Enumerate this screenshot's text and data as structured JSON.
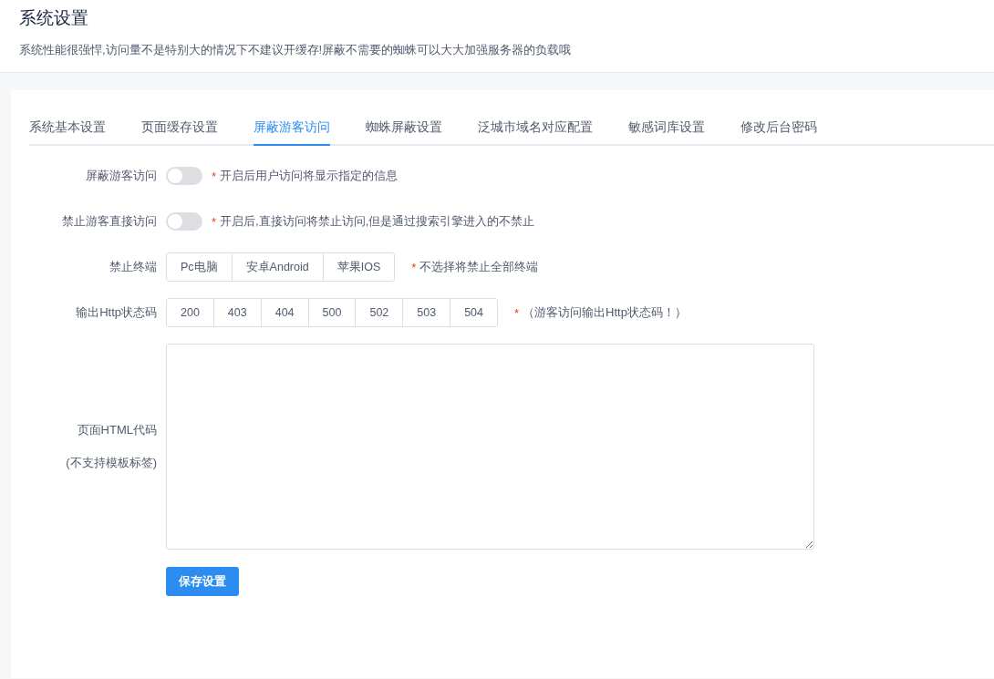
{
  "header": {
    "title": "系统设置",
    "description": "系统性能很强悍,访问量不是特别大的情况下不建议开缓存!屏蔽不需要的蜘蛛可以大大加强服务器的负载哦"
  },
  "tabs": [
    {
      "label": "系统基本设置",
      "selected": false
    },
    {
      "label": "页面缓存设置",
      "selected": false
    },
    {
      "label": "屏蔽游客访问",
      "selected": true
    },
    {
      "label": "蜘蛛屏蔽设置",
      "selected": false
    },
    {
      "label": "泛城市域名对应配置",
      "selected": false
    },
    {
      "label": "敏感词库设置",
      "selected": false
    },
    {
      "label": "修改后台密码",
      "selected": false
    }
  ],
  "form": [
    {
      "kind": "switch",
      "label": "屏蔽游客访问",
      "on": false,
      "note_mark": "*",
      "note": "开启后用户访问将显示指定的信息"
    },
    {
      "kind": "switch",
      "label": "禁止游客直接访问",
      "on": false,
      "note_mark": "*",
      "note": "开启后,直接访问将禁止访问,但是通过搜索引擎进入的不禁止"
    },
    {
      "kind": "segments",
      "label": "禁止终端",
      "options": [
        {
          "label": "Pc电脑",
          "selected": false
        },
        {
          "label": "安卓Android",
          "selected": false
        },
        {
          "label": "苹果IOS",
          "selected": false
        }
      ],
      "note_mark": "*",
      "note": "不选择将禁止全部终端"
    },
    {
      "kind": "segments",
      "label": "输出Http状态码",
      "options": [
        {
          "label": "200",
          "selected": false
        },
        {
          "label": "403",
          "selected": false
        },
        {
          "label": "404",
          "selected": false
        },
        {
          "label": "500",
          "selected": false
        },
        {
          "label": "502",
          "selected": false
        },
        {
          "label": "503",
          "selected": false
        },
        {
          "label": "504",
          "selected": false
        }
      ],
      "note_mark": "*",
      "note": "（游客访问输出Http状态码！）"
    },
    {
      "kind": "textarea",
      "label": "页面HTML代码",
      "sublabel": "(不支持模板标签)"
    }
  ],
  "save_button": "保存设置"
}
